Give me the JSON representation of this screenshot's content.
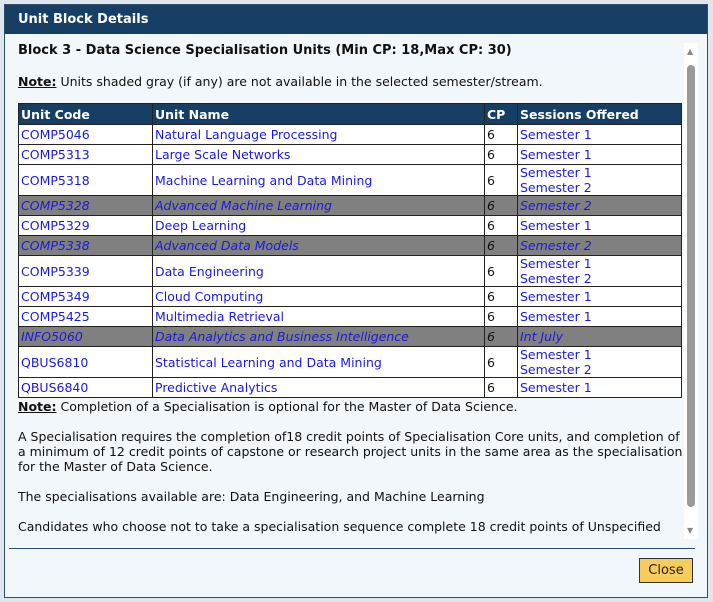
{
  "dialog": {
    "title": "Unit Block Details",
    "close_label": "Close"
  },
  "block_title": "Block 3 - Data Science Specialisation Units (Min CP: 18,Max CP: 30)",
  "note1": {
    "label": "Note:",
    "text": " Units shaded gray (if any) are not available in the selected semester/stream."
  },
  "table": {
    "headers": [
      "Unit Code",
      "Unit Name",
      "CP",
      "Sessions Offered"
    ],
    "rows": [
      {
        "code": "COMP5046",
        "name": "Natural Language Processing",
        "cp": "6",
        "sessions": [
          "Semester 1"
        ],
        "gray": false
      },
      {
        "code": "COMP5313",
        "name": "Large Scale Networks",
        "cp": "6",
        "sessions": [
          "Semester 1"
        ],
        "gray": false
      },
      {
        "code": "COMP5318",
        "name": "Machine Learning and Data Mining",
        "cp": "6",
        "sessions": [
          "Semester 1",
          "Semester 2"
        ],
        "gray": false
      },
      {
        "code": "COMP5328",
        "name": "Advanced Machine Learning",
        "cp": "6",
        "sessions": [
          "Semester 2"
        ],
        "gray": true
      },
      {
        "code": "COMP5329",
        "name": "Deep Learning",
        "cp": "6",
        "sessions": [
          "Semester 1"
        ],
        "gray": false
      },
      {
        "code": "COMP5338",
        "name": "Advanced Data Models",
        "cp": "6",
        "sessions": [
          "Semester 2"
        ],
        "gray": true
      },
      {
        "code": "COMP5339",
        "name": "Data Engineering",
        "cp": "6",
        "sessions": [
          "Semester 1",
          "Semester 2"
        ],
        "gray": false
      },
      {
        "code": "COMP5349",
        "name": "Cloud Computing",
        "cp": "6",
        "sessions": [
          "Semester 1"
        ],
        "gray": false
      },
      {
        "code": "COMP5425",
        "name": "Multimedia Retrieval",
        "cp": "6",
        "sessions": [
          "Semester 1"
        ],
        "gray": false
      },
      {
        "code": "INFO5060",
        "name": "Data Analytics and Business Intelligence",
        "cp": "6",
        "sessions": [
          "Int July"
        ],
        "gray": true
      },
      {
        "code": "QBUS6810",
        "name": "Statistical Learning and Data Mining",
        "cp": "6",
        "sessions": [
          "Semester 1",
          "Semester 2"
        ],
        "gray": false
      },
      {
        "code": "QBUS6840",
        "name": "Predictive Analytics",
        "cp": "6",
        "sessions": [
          "Semester 1"
        ],
        "gray": false
      }
    ]
  },
  "note2": {
    "label": "Note:",
    "text": " Completion of a Specialisation is optional for the Master of Data Science."
  },
  "para1": "A Specialisation requires the completion of18 credit points of Specialisation Core units, and completion of a minimum of 12 credit points of capstone or research project units in the same area as the specialisation for the Master of Data Science.",
  "para2": "The specialisations available are: Data Engineering, and Machine Learning",
  "para3": "Candidates who choose not to take a specialisation sequence complete 18 credit points of Unspecified"
}
